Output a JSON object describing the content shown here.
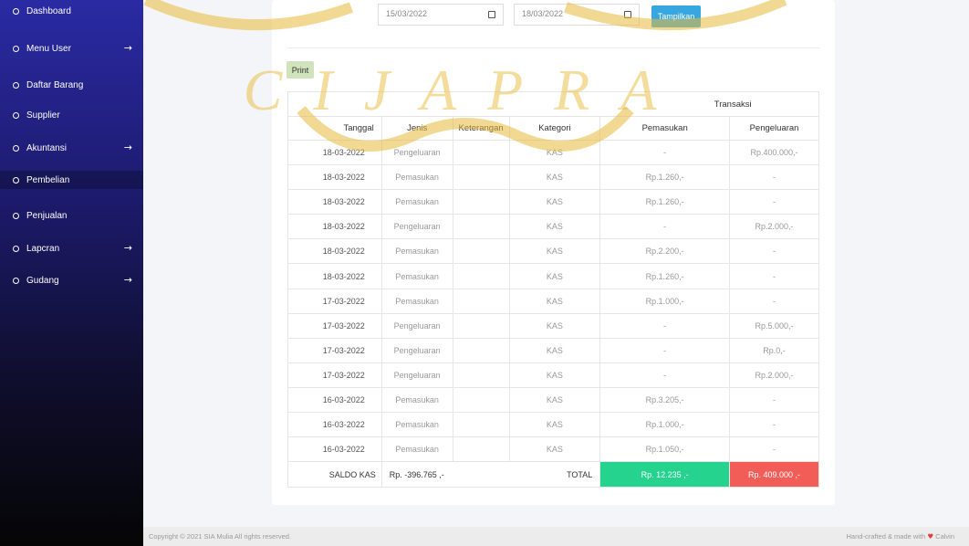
{
  "sidebar": {
    "items": [
      {
        "label": "Dashboard",
        "arrow": ""
      },
      {
        "label": "Menu User",
        "arrow": "→"
      },
      {
        "label": "Daftar Barang",
        "arrow": ""
      },
      {
        "label": "Supplier",
        "arrow": ""
      },
      {
        "label": "Akuntansi",
        "arrow": "→"
      },
      {
        "label": "Pembelian",
        "arrow": ""
      },
      {
        "label": "Penjualan",
        "arrow": ""
      },
      {
        "label": "Lapcran",
        "arrow": "→"
      },
      {
        "label": "Gudang",
        "arrow": "→"
      }
    ]
  },
  "filter": {
    "date_from": "15/03/2022",
    "date_to": "18/03/2022",
    "submit_label": "Tampilkan"
  },
  "toolbar": {
    "print_label": "Print"
  },
  "watermark": {
    "text": "CIJAPRA"
  },
  "table": {
    "group_header": "Transaksi",
    "columns": [
      "Tanggal",
      "Jenis",
      "Keterangan",
      "Kategori",
      "Pemasukan",
      "Pengeluaran"
    ],
    "rows": [
      [
        "18-03-2022",
        "Pengeluaran",
        "",
        "KAS",
        "-",
        "Rp.400.000,-"
      ],
      [
        "18-03-2022",
        "Pemasukan",
        "",
        "KAS",
        "Rp.1.260,-",
        "-"
      ],
      [
        "18-03-2022",
        "Pemasukan",
        "",
        "KAS",
        "Rp.1.260,-",
        "-"
      ],
      [
        "18-03-2022",
        "Pengeluaran",
        "",
        "KAS",
        "-",
        "Rp.2.000,-"
      ],
      [
        "18-03-2022",
        "Pemasukan",
        "",
        "KAS",
        "Rp.2.200,-",
        "-"
      ],
      [
        "18-03-2022",
        "Pemasukan",
        "",
        "KAS",
        "Rp.1.260,-",
        "-"
      ],
      [
        "17-03-2022",
        "Pemasukan",
        "",
        "KAS",
        "Rp.1.000,-",
        "-"
      ],
      [
        "17-03-2022",
        "Pengeluaran",
        "",
        "KAS",
        "-",
        "Rp.5.000,-"
      ],
      [
        "17-03-2022",
        "Pengeluaran",
        "",
        "KAS",
        "-",
        "Rp.0,-"
      ],
      [
        "17-03-2022",
        "Pengeluaran",
        "",
        "KAS",
        "-",
        "Rp.2.000,-"
      ],
      [
        "16-03-2022",
        "Pemasukan",
        "",
        "KAS",
        "Rp.3.205,-",
        "-"
      ],
      [
        "16-03-2022",
        "Pemasukan",
        "",
        "KAS",
        "Rp.1.000,-",
        "-"
      ],
      [
        "16-03-2022",
        "Pemasukan",
        "",
        "KAS",
        "Rp.1.050,-",
        "-"
      ]
    ],
    "footer": {
      "saldo_label": "SALDO KAS",
      "saldo_value": "Rp. -396.765 ,-",
      "total_label": "TOTAL",
      "total_pemasukan": "Rp. 12.235 ,-",
      "total_pengeluaran": "Rp. 409.000 ,-"
    }
  },
  "footer": {
    "copyright": "Copyright © 2021 SIA Mulia All rights reserved.",
    "credit_prefix": "Hand-crafted & made with",
    "credit_heart": "♥",
    "credit_name": "Calvin"
  },
  "colors": {
    "sidebar_top": "#2a2aa4",
    "sidebar_bottom": "#050505",
    "total_income": "#25d38e",
    "total_expense": "#f25d58",
    "submit_button": "#38a6df",
    "print_button": "#cfe3bd",
    "watermark": "#e7b93a"
  }
}
